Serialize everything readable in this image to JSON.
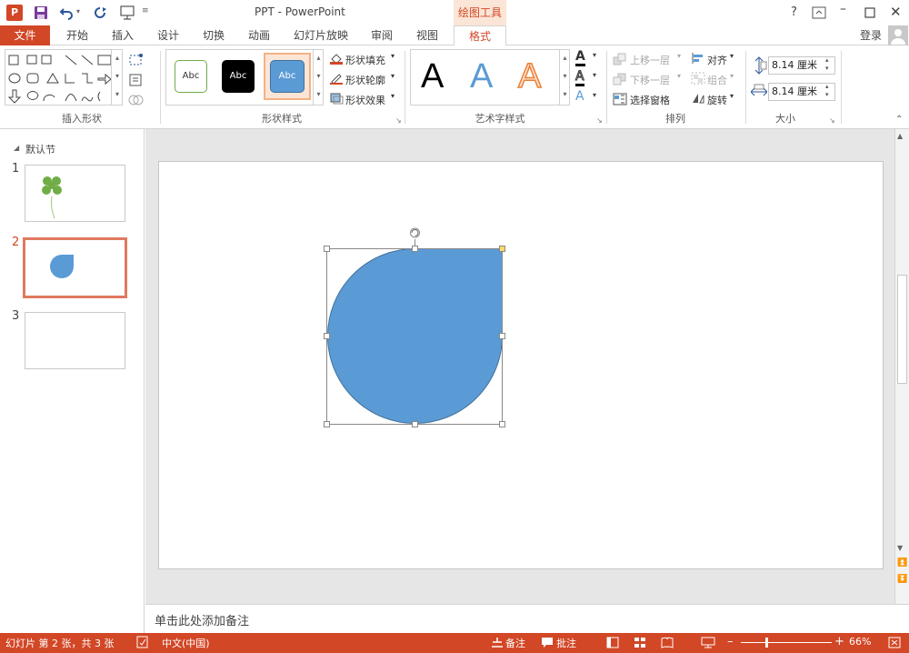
{
  "app": {
    "title": "PPT - PowerPoint",
    "contextual_tab_group": "绘图工具",
    "help": "?",
    "login": "登录"
  },
  "tabs": [
    "文件",
    "开始",
    "插入",
    "设计",
    "切换",
    "动画",
    "幻灯片放映",
    "审阅",
    "视图",
    "格式"
  ],
  "active_tab": "格式",
  "ribbon": {
    "insert_shapes_label": "插入形状",
    "shape_styles_label": "形状样式",
    "wordart_label": "艺术字样式",
    "arrange_label": "排列",
    "size_label": "大小",
    "style_samples": [
      "Abc",
      "Abc",
      "Abc"
    ],
    "wordart_samples": [
      "A",
      "A",
      "A"
    ],
    "shape_fill": "形状填充",
    "shape_outline": "形状轮廓",
    "shape_effects": "形状效果",
    "bring_forward": "上移一层",
    "send_backward": "下移一层",
    "selection_pane": "选择窗格",
    "align": "对齐",
    "group": "组合",
    "rotate": "旋转",
    "height": "8.14 厘米",
    "width": "8.14 厘米"
  },
  "slides_pane": {
    "section": "默认节",
    "slides": [
      {
        "num": "1",
        "content": "clover"
      },
      {
        "num": "2",
        "content": "teardrop"
      },
      {
        "num": "3",
        "content": "blank"
      }
    ],
    "selected": "2"
  },
  "notes_placeholder": "单击此处添加备注",
  "status": {
    "slide_info": "幻灯片 第 2 张，共 3 张",
    "language": "中文(中国)",
    "notes_btn": "备注",
    "comments_btn": "批注",
    "zoom": "66%"
  },
  "colors": {
    "accent": "#d24726",
    "shape_fill": "#5b9bd5",
    "clover": "#70ad47"
  }
}
